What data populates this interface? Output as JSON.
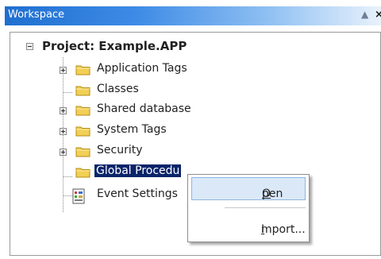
{
  "window": {
    "title": "Workspace",
    "pin_glyph": "▲",
    "close_glyph": "×"
  },
  "tree": {
    "root_label": "Project: Example.APP",
    "items": [
      {
        "label": "Application Tags",
        "icon": "folder-icon",
        "expandable": true
      },
      {
        "label": "Classes",
        "icon": "folder-icon",
        "expandable": false
      },
      {
        "label": "Shared database",
        "icon": "folder-icon",
        "expandable": true
      },
      {
        "label": "System Tags",
        "icon": "folder-icon",
        "expandable": true
      },
      {
        "label": "Security",
        "icon": "folder-icon",
        "expandable": true
      },
      {
        "label": "Global Procedu",
        "icon": "folder-icon",
        "expandable": false,
        "selected": true
      },
      {
        "label": "Event Settings",
        "icon": "event-settings-icon",
        "expandable": false
      }
    ]
  },
  "context_menu": {
    "open": {
      "key": "O",
      "rest": "pen"
    },
    "import": {
      "key": "I",
      "rest": "mport..."
    }
  },
  "colors": {
    "selection": "#0a246a",
    "titlebar": "#1f6fd0",
    "menu_highlight": "#dbe8f8",
    "folder": "#f2cf55"
  }
}
